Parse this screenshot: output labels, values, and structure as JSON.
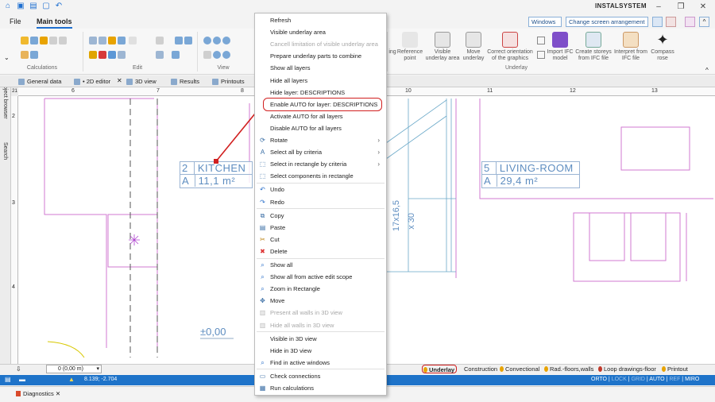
{
  "app": {
    "logo_text": "INSTALSYSTEM"
  },
  "menu": {
    "tabs": [
      {
        "label": "File"
      },
      {
        "label": "Main tools"
      }
    ],
    "windows_label": "Windows",
    "screen_arrangement_label": "Change screen arrangement"
  },
  "ribbon": {
    "groups": [
      "Calculations",
      "Edit",
      "View",
      "Underlay"
    ],
    "underlay_buttons": [
      {
        "label": "ing"
      },
      {
        "label": "Reference point"
      },
      {
        "label": "Visible underlay area"
      },
      {
        "label": "Move underlay"
      },
      {
        "label": "Correct orientation of the graphics"
      },
      {
        "label": "Import IFC model"
      },
      {
        "label": "Create storeys from IFC file"
      },
      {
        "label": "Interpret from IFC file"
      },
      {
        "label": "Compass rose"
      }
    ]
  },
  "doc_tabs": [
    {
      "label": "General data"
    },
    {
      "label": "• 2D editor"
    },
    {
      "label": "3D view"
    },
    {
      "label": "Results"
    },
    {
      "label": "Printouts"
    }
  ],
  "side_panels": [
    "Project browser",
    "Search"
  ],
  "ruler": {
    "corner": "21",
    "h_numbers": [
      "6",
      "7",
      "8",
      "10",
      "11",
      "12",
      "13"
    ],
    "v_numbers": [
      "2",
      "3",
      "4"
    ]
  },
  "canvas": {
    "rooms": [
      {
        "number": "2",
        "name": "KITCHEN",
        "area": "11,1 m²",
        "code": "A"
      },
      {
        "number": "5",
        "name": "LIVING-ROOM",
        "area": "29,4 m²",
        "code": "A"
      }
    ],
    "level_mark": "±0,00",
    "stair_dims": [
      "17x16,5",
      "x 30"
    ]
  },
  "context_menu": {
    "items": [
      {
        "label": "Refresh",
        "icon": "none",
        "enabled": true
      },
      {
        "label": "Visible underlay area",
        "icon": "none",
        "enabled": true
      },
      {
        "label": "Cancell limitation of visible underlay area",
        "icon": "none",
        "enabled": false
      },
      {
        "label": "Prepare underlay parts to combine",
        "icon": "none",
        "enabled": true
      },
      {
        "label": "Show all layers",
        "icon": "none",
        "enabled": true
      },
      {
        "label": "Hide all layers",
        "icon": "none",
        "enabled": true
      },
      {
        "label": "Hide layer: DESCRIPTIONS",
        "icon": "none",
        "enabled": true
      },
      {
        "label": "Enable AUTO for layer: DESCRIPTIONS",
        "icon": "none",
        "enabled": true
      },
      {
        "label": "Activate AUTO for all layers",
        "icon": "none",
        "enabled": true
      },
      {
        "label": "Disable AUTO for all layers",
        "icon": "none",
        "enabled": true
      },
      {
        "label": "Rotate",
        "icon": "rotate-icon",
        "enabled": true,
        "submenu": true
      },
      {
        "label": "Select all by criteria",
        "icon": "select-criteria-icon",
        "enabled": true,
        "submenu": true
      },
      {
        "label": "Select in rectangle by criteria",
        "icon": "select-rect-criteria-icon",
        "enabled": true,
        "submenu": true
      },
      {
        "label": "Select components in rectangle",
        "icon": "select-components-icon",
        "enabled": true
      },
      {
        "label": "Undo",
        "icon": "undo-icon",
        "enabled": true
      },
      {
        "label": "Redo",
        "icon": "redo-icon",
        "enabled": true
      },
      {
        "label": "Copy",
        "icon": "copy-icon",
        "enabled": true
      },
      {
        "label": "Paste",
        "icon": "paste-icon",
        "enabled": true
      },
      {
        "label": "Cut",
        "icon": "cut-icon",
        "enabled": true
      },
      {
        "label": "Delete",
        "icon": "delete-icon",
        "enabled": true
      },
      {
        "label": "Show all",
        "icon": "zoom-icon",
        "enabled": true
      },
      {
        "label": "Show all from active edit scope",
        "icon": "zoom-icon",
        "enabled": true
      },
      {
        "label": "Zoom in Rectangle",
        "icon": "zoom-icon",
        "enabled": true
      },
      {
        "label": "Move",
        "icon": "move-icon",
        "enabled": true
      },
      {
        "label": "Present all walls in 3D view",
        "icon": "walls-icon",
        "enabled": false
      },
      {
        "label": "Hide all walls in 3D view",
        "icon": "walls-icon",
        "enabled": false
      },
      {
        "label": "Visible in 3D view",
        "icon": "none",
        "enabled": true
      },
      {
        "label": "Hide in 3D view",
        "icon": "none",
        "enabled": true
      },
      {
        "label": "Find in active windows",
        "icon": "find-icon",
        "enabled": true
      },
      {
        "label": "Check connections",
        "icon": "check-connections-icon",
        "enabled": true
      },
      {
        "label": "Run calculations",
        "icon": "calculations-icon",
        "enabled": true
      }
    ]
  },
  "layer_tabs": [
    {
      "label": "Underlay",
      "active": true
    },
    {
      "label": "Construction",
      "active": false
    },
    {
      "label": "Convectional",
      "active": false
    },
    {
      "label": "Rad.-floors,walls",
      "active": false
    },
    {
      "label": "Loop drawings-floor",
      "active": false
    },
    {
      "label": "Printout",
      "active": false
    }
  ],
  "level_select": "0 (0,00 m)",
  "status": {
    "coords": "8.139; -2.704",
    "modes": [
      "ORTO",
      "LOCK",
      "GRID",
      "AUTO",
      "REF",
      "MIRO"
    ]
  },
  "bottom_panel": {
    "title": "Diagnostics"
  },
  "colors": {
    "accent": "#1e73c9",
    "highlight": "#d11f1f",
    "room_label": "#5e8dc0",
    "wall_line": "#d27ad2"
  }
}
